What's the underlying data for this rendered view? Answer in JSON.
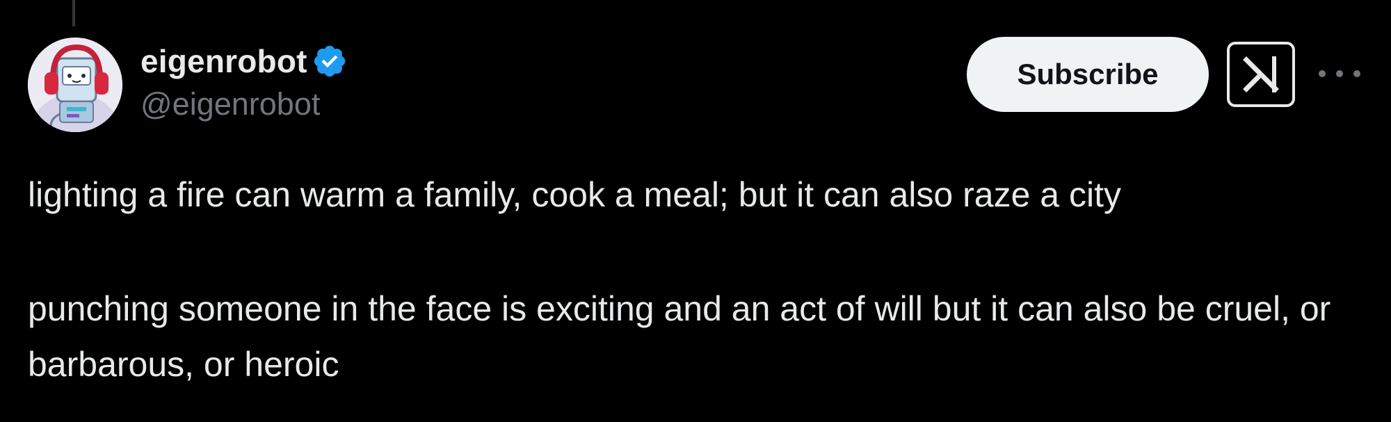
{
  "author": {
    "display_name": "eigenrobot",
    "handle": "@eigenrobot",
    "verified": true,
    "avatar_icon": "robot-avatar-with-red-headphones"
  },
  "actions": {
    "subscribe_label": "Subscribe",
    "grok_icon": "grok-icon",
    "more_icon": "more-dots-icon"
  },
  "tweet": {
    "paragraphs": [
      "lighting a fire can warm a family, cook a meal; but it can also raze a city",
      "punching someone in the face is exciting and an act of will but it can also be cruel, or barbarous, or heroic"
    ]
  },
  "colors": {
    "background": "#000000",
    "text_primary": "#e7e9ea",
    "text_secondary": "#71767b",
    "verified_blue": "#1d9bf0",
    "button_bg": "#eff3f4"
  }
}
